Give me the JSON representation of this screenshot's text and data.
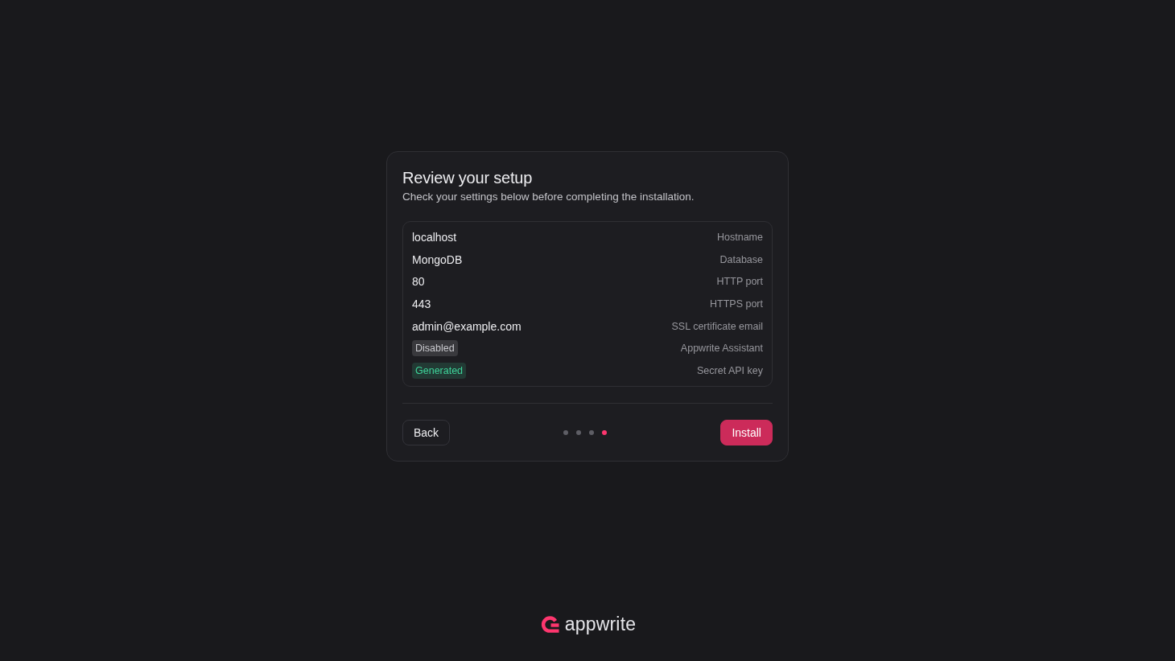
{
  "card": {
    "title": "Review your setup",
    "subtitle": "Check your settings below before completing the installation.",
    "rows": [
      {
        "kind": "text",
        "value": "localhost",
        "label": "Hostname"
      },
      {
        "kind": "text",
        "value": "MongoDB",
        "label": "Database"
      },
      {
        "kind": "text",
        "value": "80",
        "label": "HTTP port"
      },
      {
        "kind": "text",
        "value": "443",
        "label": "HTTPS port"
      },
      {
        "kind": "text",
        "value": "admin@example.com",
        "label": "SSL certificate email"
      },
      {
        "kind": "badge",
        "value": "Disabled",
        "color": "#c9c9ce",
        "label": "Appwrite Assistant"
      },
      {
        "kind": "badge",
        "value": "Generated",
        "color": "#3ed49a",
        "label": "Secret API key"
      }
    ],
    "back_button": "Back",
    "steps": [
      {
        "selected": false
      },
      {
        "selected": false
      },
      {
        "selected": false
      },
      {
        "selected": true
      }
    ],
    "install_button": "Install"
  },
  "footer": {
    "logo_text": "appwrite"
  }
}
